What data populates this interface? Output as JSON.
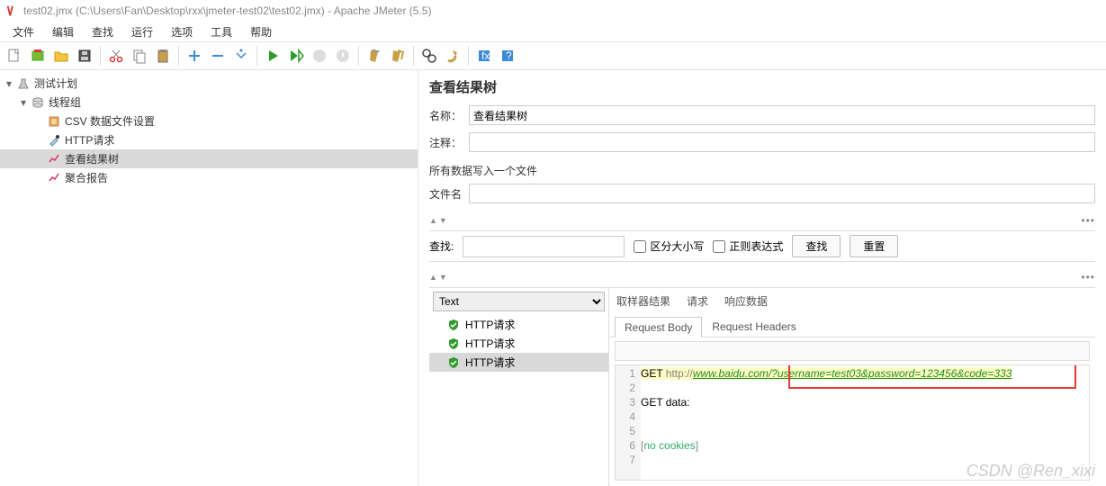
{
  "window": {
    "title": "test02.jmx (C:\\Users\\Fan\\Desktop\\rxx\\jmeter-test02\\test02.jmx) - Apache JMeter (5.5)"
  },
  "menu": [
    "文件",
    "编辑",
    "查找",
    "运行",
    "选项",
    "工具",
    "帮助"
  ],
  "tree": {
    "root": "测试计划",
    "group": "线程组",
    "items": [
      "CSV 数据文件设置",
      "HTTP请求",
      "查看结果树",
      "聚合报告"
    ],
    "selected": "查看结果树"
  },
  "panel": {
    "title": "查看结果树",
    "name_label": "名称：",
    "name_value": "查看结果树",
    "comment_label": "注释：",
    "comment_value": "",
    "file_section": "所有数据写入一个文件",
    "filename_label": "文件名",
    "filename_value": ""
  },
  "search": {
    "label": "查找:",
    "value": "",
    "case": "区分大小写",
    "regex": "正则表达式",
    "find_btn": "查找",
    "reset_btn": "重置"
  },
  "results": {
    "dropdown": "Text",
    "samples": [
      "HTTP请求",
      "HTTP请求",
      "HTTP请求"
    ],
    "selected_index": 2
  },
  "tabs1": [
    "取样器结果",
    "请求",
    "响应数据"
  ],
  "tabs1_active": 1,
  "tabs2": [
    "Request Body",
    "Request Headers"
  ],
  "tabs2_active": 0,
  "code": {
    "l1_method": "GET ",
    "l1_proto": "http://",
    "l1_url": "www.baidu.com/?username=test03&password=123456&code=333",
    "l2": "",
    "l3": "GET data:",
    "l4": "",
    "l5": "",
    "l6_a": "[",
    "l6_b": "no cookies",
    "l6_c": "]",
    "l7": ""
  },
  "watermark": "CSDN @Ren_xixi"
}
